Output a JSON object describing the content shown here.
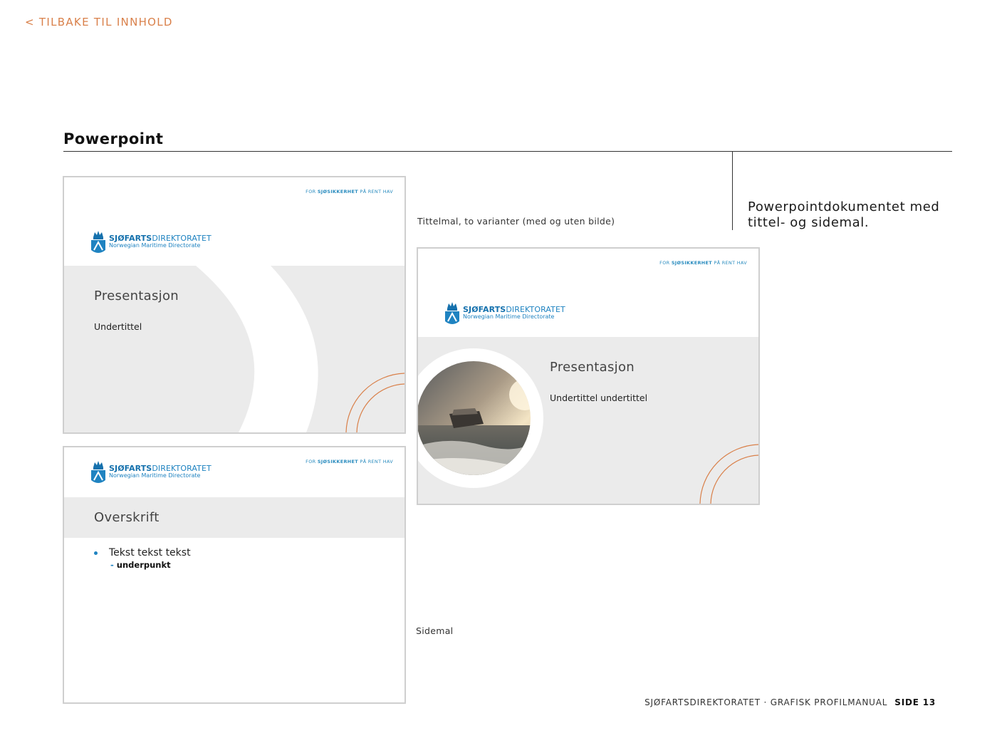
{
  "nav": {
    "back_link": "< TILBAKE TIL INNHOLD"
  },
  "section": {
    "title": "Powerpoint",
    "intro": "Powerpointdokumentet med tittel- og sidemal."
  },
  "captions": {
    "title_template": "Tittelmal, to varianter (med og uten bilde)",
    "page_template": "Sidemal"
  },
  "brand": {
    "tagline_prefix": "FOR",
    "tagline_bold": "SJØSIKKERHET",
    "tagline_suffix": "PÅ RENT HAV",
    "name_bold": "SJØFARTS",
    "name_regular": "DIREKTORATET",
    "subtitle": "Norwegian Maritime Directorate",
    "blue": "#1f83c1",
    "orange": "#d9804a",
    "band_gray": "#ebebeb"
  },
  "slides": {
    "title_plain": {
      "title": "Presentasjon",
      "subtitle": "Undertittel"
    },
    "title_image": {
      "title": "Presentasjon",
      "subtitle": "Undertittel undertittel"
    },
    "page": {
      "heading": "Overskrift",
      "bullet": "Tekst tekst tekst",
      "sub_dash": "-",
      "sub_point": "underpunkt"
    }
  },
  "footer": {
    "text": "SJØFARTSDIREKTORATET · GRAFISK PROFILMANUAL",
    "page": "SIDE 13"
  }
}
